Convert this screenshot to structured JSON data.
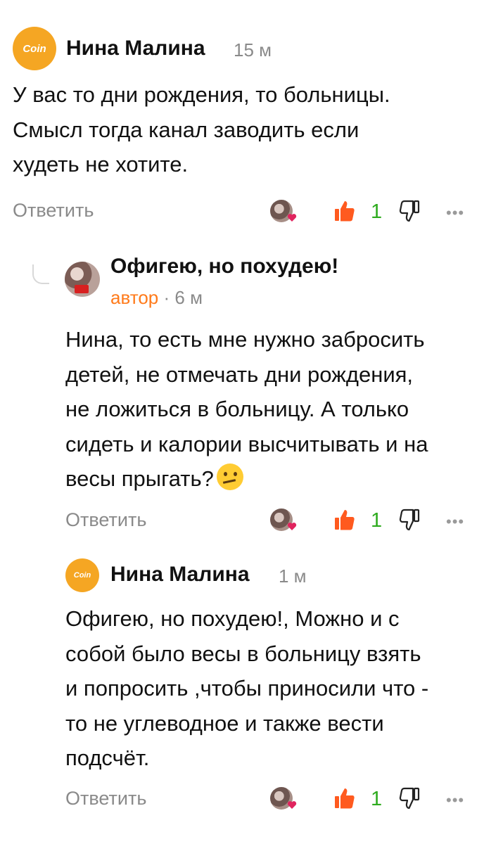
{
  "comments": [
    {
      "author": "Нина Малина",
      "avatar_text": "Coin",
      "time": "15 м",
      "lines": [
        "У вас то дни рождения, то больницы.",
        "Смысл тогда канал заводить если",
        "худеть не хотите."
      ],
      "reply_label": "Ответить",
      "likes": "1"
    },
    {
      "author": "Офигею, но похудею!",
      "author_tag": "автор",
      "separator": "·",
      "time": "6 м",
      "lines": [
        "Нина, то есть мне нужно забросить",
        "детей, не отмечать дни рождения,",
        "не ложиться в больницу. А только",
        "сидеть и калории высчитывать и на",
        "весы прыгать?"
      ],
      "emoji": "thinking-face",
      "reply_label": "Ответить",
      "likes": "1"
    },
    {
      "author": "Нина Малина",
      "avatar_text": "Coin",
      "time": "1 м",
      "lines": [
        "Офигею, но похудею!, Можно и с",
        "собой было весы в больницу взять",
        "и попросить ,чтобы приносили что -",
        "то не углеводное и также вести",
        "подсчёт."
      ],
      "reply_label": "Ответить",
      "likes": "1"
    }
  ],
  "icons": {
    "like": "thumbs-up-icon",
    "dislike": "thumbs-down-icon",
    "more": "more-dots-icon",
    "more_glyph": "•••"
  },
  "colors": {
    "accent": "#ff7a1a",
    "like_count": "#2eab1f",
    "coin_avatar": "#f5a623",
    "muted": "#8a8a8a"
  }
}
